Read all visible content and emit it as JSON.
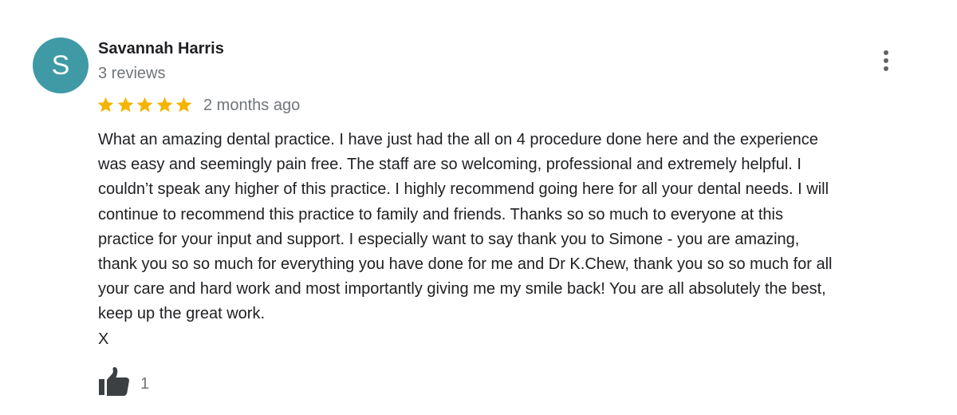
{
  "reviewer": {
    "initial": "S",
    "avatar_color": "#3f9aa5",
    "name": "Savannah Harris",
    "review_count": "3 reviews"
  },
  "review": {
    "rating": 5,
    "rating_max": 5,
    "star_color": "#f4b400",
    "date": "2 months ago",
    "text": "What an amazing dental practice. I have just  had the all on 4 procedure done here and the experience\nwas easy and seemingly pain free. The staff are so welcoming, professional and extremely helpful. I\ncouldn’t speak any higher of this practice. I highly recommend going here for all your dental needs. I will\ncontinue to recommend this practice to family and friends. Thanks so so much to everyone at this\npractice for your input and support. I especially want to say thank you to Simone - you are amazing,\nthank you so so much for everything you have done for me and Dr K.Chew, thank you so so much for all\nyour care and hard work and most importantly giving me my smile back! You are all absolutely the best,\nkeep up the great work.\nX"
  },
  "actions": {
    "more_icon": "more-vert-icon",
    "like_icon": "thumbs-up-icon",
    "like_count": "1"
  }
}
